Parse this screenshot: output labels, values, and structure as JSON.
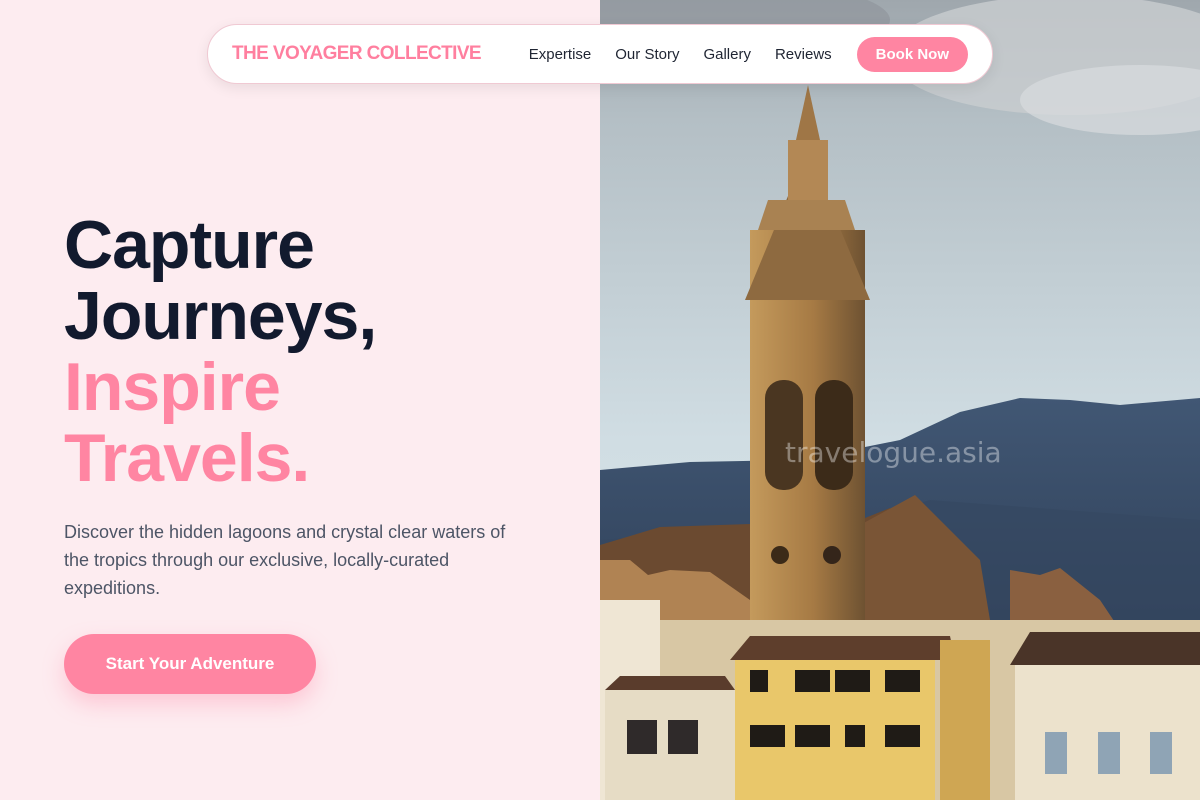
{
  "brand": "THE VOYAGER COLLECTIVE",
  "nav": {
    "links": [
      "Expertise",
      "Our Story",
      "Gallery",
      "Reviews"
    ],
    "cta": "Book Now"
  },
  "hero": {
    "title_line1": "Capture",
    "title_line2": "Journeys,",
    "title_line3": "Inspire",
    "title_line4": "Travels.",
    "description": "Discover the hidden lagoons and crystal clear waters of the tropics through our exclusive, locally-curated expeditions.",
    "cta": "Start Your Adventure"
  },
  "photo": {
    "watermark": "travelogue.asia"
  },
  "colors": {
    "accent": "#ff85a2",
    "background": "#fdecf0",
    "heading": "#121a2e",
    "body_text": "#4d5566"
  }
}
